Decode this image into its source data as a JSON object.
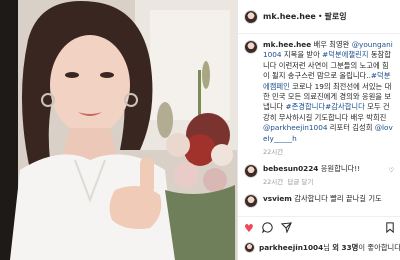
{
  "post": {
    "username": "mk.hee.hee",
    "dot": "•",
    "follow_label": "팔로잉"
  },
  "caption": {
    "username": "mk.hee.hee",
    "text_1": " 배우 최영완 ",
    "mention_1": "@youngani1004",
    "text_2": " 지목을 받아 ",
    "tag_1": "#덕분에챌린지",
    "text_3": " 동참합니다 이런저런 사연이 그분들의 노고에 힘이 될지 송구스런 맘으로 올립니다..",
    "tag_2": "#덕분에캠페인",
    "text_4": " 코로나 19의 최전선에 서있는 대한 민국 모든 의료진에게 경의와 응원을 보냅니다 ",
    "tag_3": "#존경합니다",
    "tag_4": "#감사합니다",
    "text_5": " 모두 건강히 무사하시길 기도합니다 배우 박희진 ",
    "mention_2": "@parkheejin1004",
    "text_6": " 리포터 김성희 ",
    "mention_3": "@lovely_____h",
    "time": "22시간"
  },
  "comments": [
    {
      "username": "bebesun0224",
      "text": " 응원합니다!!",
      "time": "22시간",
      "reply_label": "답글 달기"
    },
    {
      "username": "vsviem",
      "text": " 감사합니다 빨리 끝나길 기도",
      "time": ""
    }
  ],
  "likes": {
    "by_user": "parkheejin1004",
    "middle": "님 ",
    "count_text": "외 33명",
    "suffix": "이 좋아합니다"
  },
  "icons": [
    "heart-icon",
    "comment-icon",
    "share-icon",
    "bookmark-icon"
  ],
  "colors": {
    "like_heart": "#ed4956",
    "link": "#1d4f8c"
  }
}
